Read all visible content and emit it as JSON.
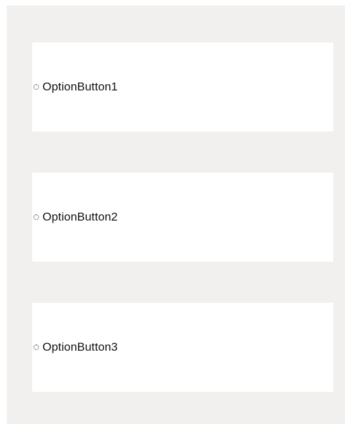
{
  "options": [
    {
      "label": "OptionButton1",
      "selected": false
    },
    {
      "label": "OptionButton2",
      "selected": false
    },
    {
      "label": "OptionButton3",
      "selected": false
    }
  ],
  "colors": {
    "form_background": "#f1f0ef",
    "panel_background": "#ffffff",
    "text": "#111111"
  }
}
